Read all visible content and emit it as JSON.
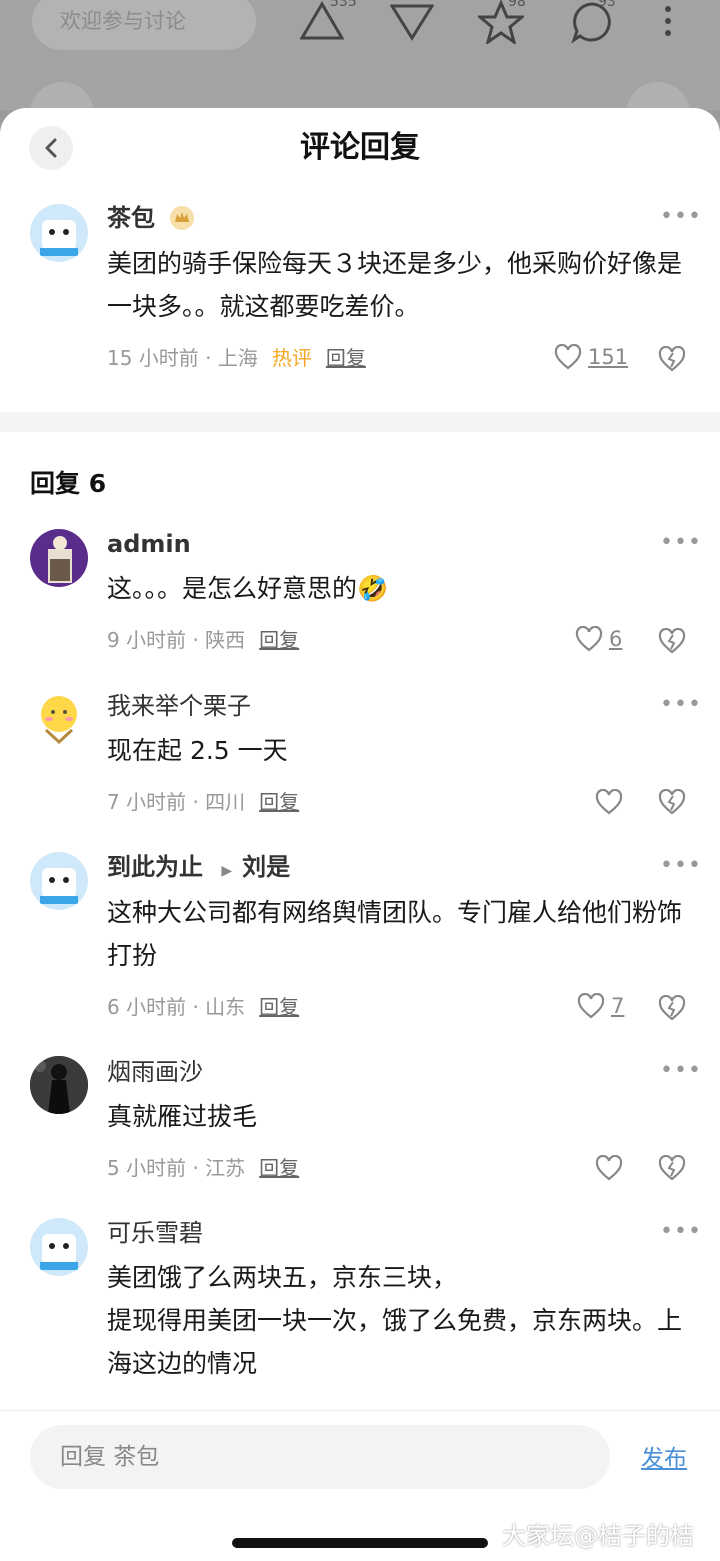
{
  "background": {
    "search_placeholder": "欢迎参与讨论",
    "upvote_count": "535",
    "favorite_count": "98",
    "comment_count": "93"
  },
  "sheet": {
    "title": "评论回复"
  },
  "main_comment": {
    "author": "茶包",
    "text": "美团的骑手保险每天３块还是多少，他采购价好像是一块多。。就这都要吃差价。",
    "time": "15 小时前",
    "location": "上海",
    "hot_label": "热评",
    "reply_label": "回复",
    "likes": "151"
  },
  "replies_header": "回复 6",
  "replies": [
    {
      "author": "admin",
      "text": "这。。。是怎么好意思的🤣",
      "time": "9 小时前",
      "location": "陕西",
      "reply_label": "回复",
      "likes": "6"
    },
    {
      "author": "我来举个栗子",
      "text": "现在起 2.5 一天",
      "time": "7 小时前",
      "location": "四川",
      "reply_label": "回复",
      "likes": ""
    },
    {
      "author": "到此为止",
      "reply_to": "刘是",
      "text": "这种大公司都有网络舆情团队。专门雇人给他们粉饰打扮",
      "time": "6 小时前",
      "location": "山东",
      "reply_label": "回复",
      "likes": "7"
    },
    {
      "author": "烟雨画沙",
      "text": "真就雁过拔毛",
      "time": "5 小时前",
      "location": "江苏",
      "reply_label": "回复",
      "likes": ""
    },
    {
      "author": "可乐雪碧",
      "text_lines": [
        "美团饿了么两块五，京东三块，",
        "提现得用美团一块一次，饿了么免费，京东两块。上海这边的情况"
      ]
    }
  ],
  "bottom": {
    "input_placeholder": "回复 茶包",
    "publish_label": "发布"
  },
  "watermark": "大家坛@桔子的桔"
}
